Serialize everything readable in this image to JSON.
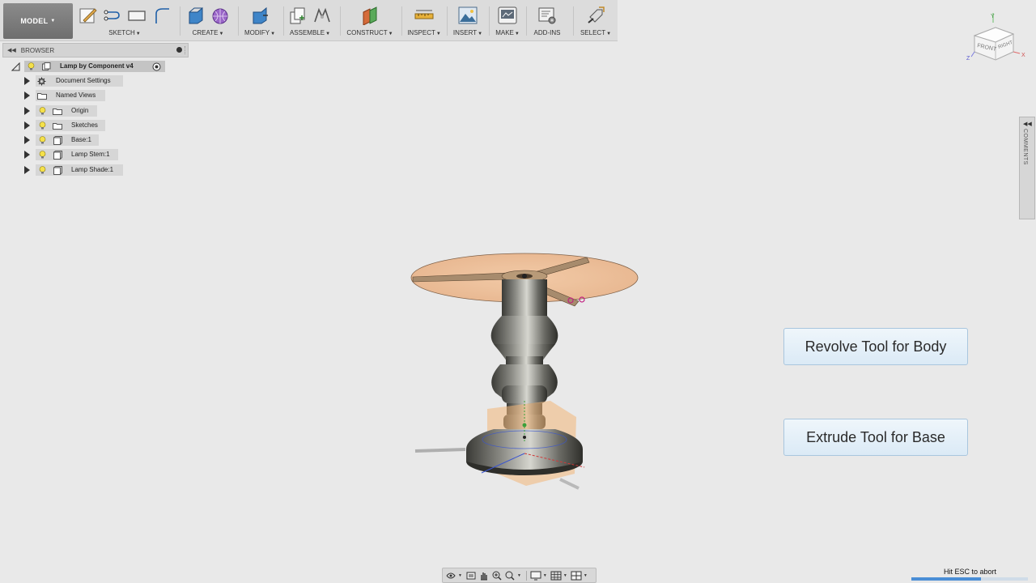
{
  "toolbar": {
    "workspace": "MODEL",
    "groups": [
      {
        "label": "SKETCH"
      },
      {
        "label": "CREATE"
      },
      {
        "label": "MODIFY"
      },
      {
        "label": "ASSEMBLE"
      },
      {
        "label": "CONSTRUCT"
      },
      {
        "label": "INSPECT"
      },
      {
        "label": "INSERT"
      },
      {
        "label": "MAKE"
      },
      {
        "label": "ADD-INS"
      },
      {
        "label": "SELECT"
      }
    ]
  },
  "browser": {
    "title": "BROWSER",
    "root": "Lamp by Component v4",
    "items": [
      {
        "label": "Document Settings",
        "icon": "gear-icon"
      },
      {
        "label": "Named Views",
        "icon": "folder-icon"
      },
      {
        "label": "Origin",
        "icon": "folder-icon"
      },
      {
        "label": "Sketches",
        "icon": "folder-icon"
      },
      {
        "label": "Base:1",
        "icon": "component-icon"
      },
      {
        "label": "Lamp Stem:1",
        "icon": "component-icon"
      },
      {
        "label": "Lamp Shade:1",
        "icon": "component-icon"
      }
    ]
  },
  "viewcube": {
    "top": "Y",
    "front": "FRONT",
    "right": "RIGHT",
    "z": "Z",
    "x": "X"
  },
  "comments_tab": "COMMENTS",
  "callouts": {
    "revolve": "Revolve Tool for Body",
    "extrude": "Extrude Tool for Base"
  },
  "status": {
    "escape_hint": "Hit ESC to abort",
    "progress": 0.6
  },
  "colors": {
    "callout_border": "#a9c6de",
    "progress_fill": "#4a8ed6",
    "sketch_plane": "#f2b679"
  }
}
